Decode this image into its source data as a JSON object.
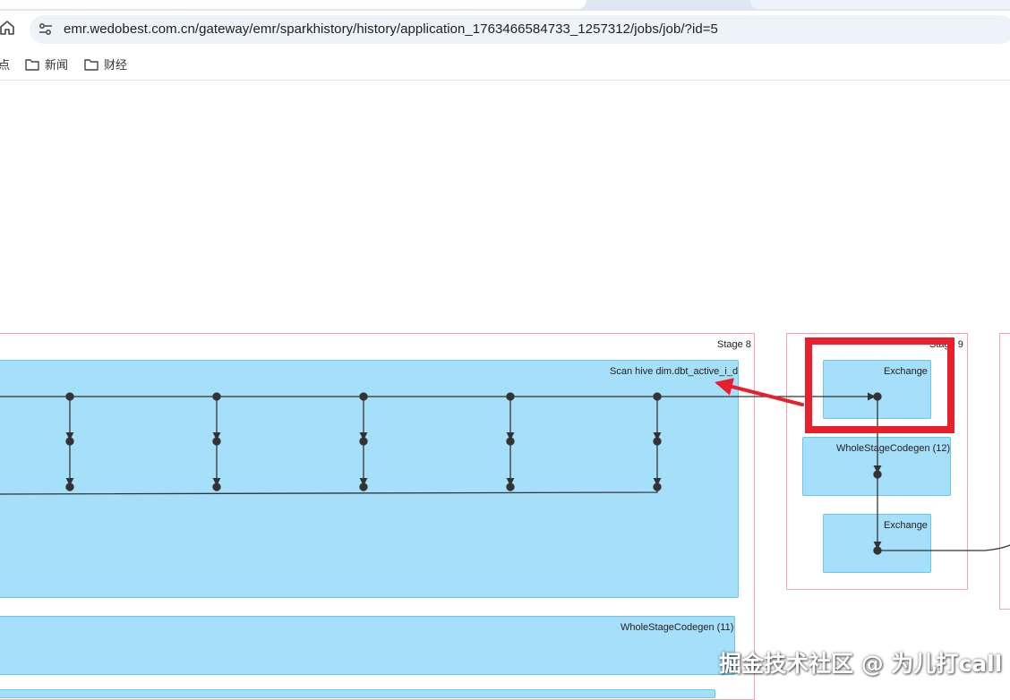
{
  "browser": {
    "url": "emr.wedobest.com.cn/gateway/emr/sparkhistory/history/application_1763466584733_1257312/jobs/job/?id=5",
    "bookmarks": [
      "点",
      "新闻",
      "财经"
    ]
  },
  "dag": {
    "stages": [
      {
        "label": "Stage 8"
      },
      {
        "label": "Stage 9"
      }
    ],
    "nodes": {
      "scan_hive": "Scan hive dim.dbt_active_i_d",
      "wscg_11": "WholeStageCodegen (11)",
      "exchange_top": "Exchange",
      "wscg_12": "WholeStageCodegen (12)",
      "exchange_bottom": "Exchange"
    }
  },
  "annotation": {
    "highlight_color": "#e8202c",
    "arrow_color": "#e8202c"
  },
  "watermark": "掘金技术社区 @ 为儿打call",
  "colors": {
    "node_fill": "#a5dff9",
    "node_border": "#6cc6ee",
    "stage_border": "#f4a5b4",
    "edge": "#333333"
  }
}
